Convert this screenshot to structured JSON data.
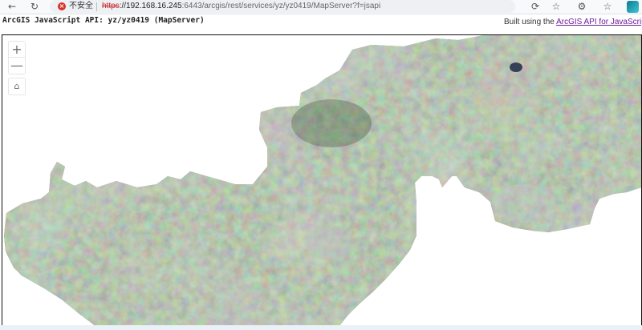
{
  "browser": {
    "security_label": "不安全",
    "url_scheme": "https",
    "url_host": "://192.168.16.245",
    "url_rest": ":6443/arcgis/rest/services/yz/yz0419/MapServer?f=jsapi"
  },
  "header": {
    "title": "ArcGIS JavaScript API: yz/yz0419 (MapServer)",
    "credit_prefix": "Built using the",
    "credit_link": "ArcGIS API for JavaScript"
  },
  "map": {
    "zoom_in_label": "+",
    "zoom_out_label": "—"
  },
  "colors": {
    "accent_link": "#6a1b9a",
    "insecure": "#d93025"
  },
  "icons": [
    "back-icon",
    "reload-icon",
    "insecure-icon",
    "reader-icon",
    "favorite-icon",
    "extensions-icon",
    "favorites-bar-icon",
    "edge-icon",
    "home-icon"
  ]
}
